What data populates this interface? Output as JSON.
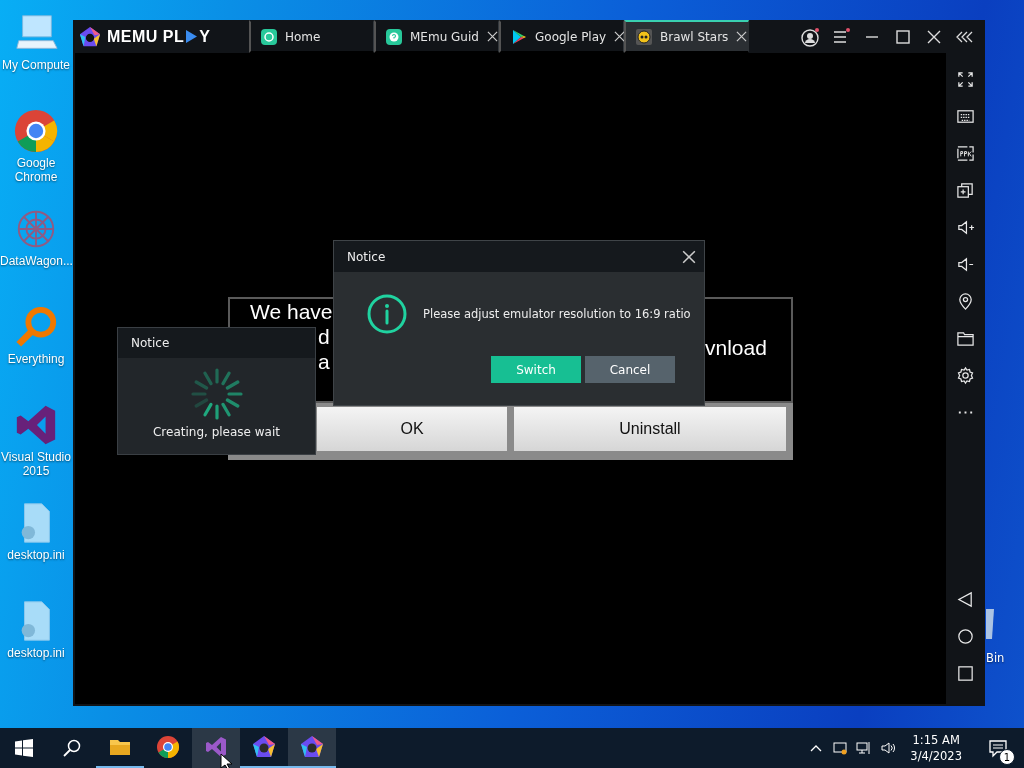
{
  "desktop_icons": [
    {
      "label": "My Compute",
      "kind": "computer"
    },
    {
      "label": "Google Chrome",
      "kind": "chrome"
    },
    {
      "label": "DataWagon...",
      "kind": "datawagon"
    },
    {
      "label": "Everything",
      "kind": "everything"
    },
    {
      "label": "Visual Studio 2015",
      "kind": "vs"
    },
    {
      "label": "desktop.ini",
      "kind": "file"
    },
    {
      "label": "desktop.ini",
      "kind": "file"
    }
  ],
  "recycle_bin": {
    "label": "Bin"
  },
  "emulator": {
    "logo": {
      "before": "MEMU PL",
      "after": "Y"
    },
    "tabs": [
      {
        "label": "Home",
        "kind": "home",
        "closable": false,
        "selected": false
      },
      {
        "label": "MEmu Guid",
        "kind": "help",
        "closable": true,
        "selected": false
      },
      {
        "label": "Google Play",
        "kind": "store",
        "closable": true,
        "selected": false
      },
      {
        "label": "Brawl Stars",
        "kind": "game",
        "closable": true,
        "selected": true
      }
    ]
  },
  "game_dialog": {
    "left_lines": [
      "We have",
      "d",
      "a"
    ],
    "right_text": "vnload",
    "buttons": [
      "OK",
      "Uninstall"
    ]
  },
  "progress_notice": {
    "title": "Notice",
    "message": "Creating, please wait"
  },
  "notice": {
    "title": "Notice",
    "message": "Please adjust emulator resolution to 16:9 ratio",
    "buttons": [
      {
        "label": "Switch",
        "kind": "primary"
      },
      {
        "label": "Cancel",
        "kind": "secondary"
      }
    ]
  },
  "taskbar": {
    "apps": [
      {
        "kind": "explorer",
        "running": true,
        "highlighted": false
      },
      {
        "kind": "chrome",
        "running": false,
        "highlighted": false
      },
      {
        "kind": "vs",
        "running": false,
        "highlighted": true
      },
      {
        "kind": "memu",
        "running": true,
        "highlighted": false
      },
      {
        "kind": "memu",
        "running": true,
        "highlighted": true
      }
    ],
    "time": "1:15 AM",
    "date": "3/4/2023",
    "notification_count": "1"
  }
}
